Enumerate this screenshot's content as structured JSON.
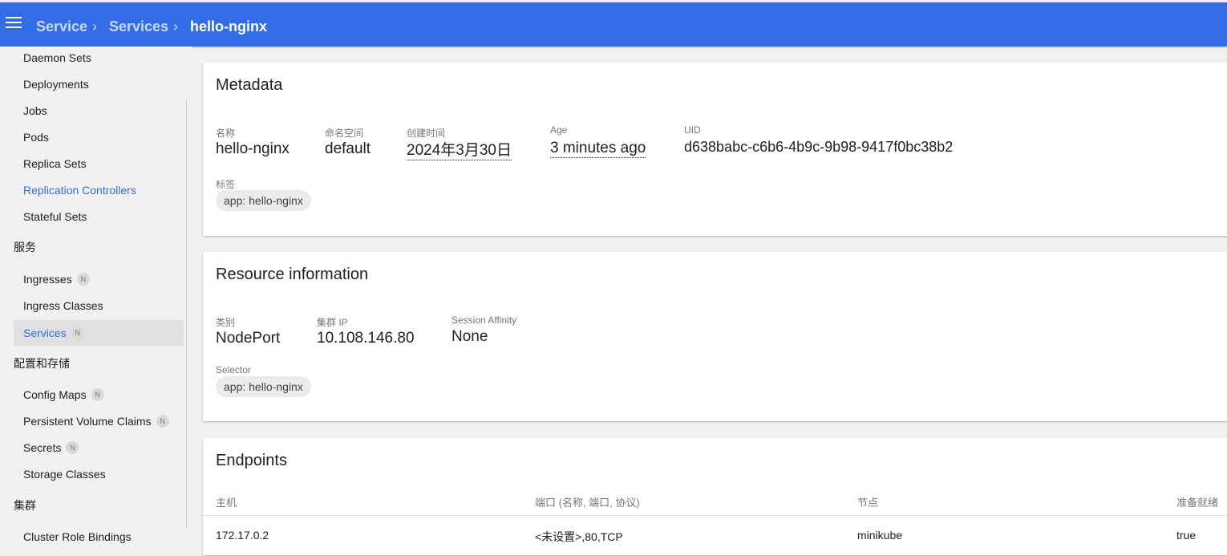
{
  "breadcrumb": {
    "items": [
      "Service",
      "Services"
    ],
    "current": "hello-nginx"
  },
  "sidebar": {
    "workloads": [
      "Daemon Sets",
      "Deployments",
      "Jobs",
      "Pods",
      "Replica Sets",
      "Replication Controllers",
      "Stateful Sets"
    ],
    "section_services": "服务",
    "services_items": [
      {
        "label": "Ingresses",
        "badge": "N"
      },
      {
        "label": "Ingress Classes"
      },
      {
        "label": "Services",
        "badge": "N",
        "selected": true
      }
    ],
    "section_config": "配置和存储",
    "config_items": [
      {
        "label": "Config Maps",
        "badge": "N"
      },
      {
        "label": "Persistent Volume Claims",
        "badge": "N"
      },
      {
        "label": "Secrets",
        "badge": "N"
      },
      {
        "label": "Storage Classes"
      }
    ],
    "section_cluster": "集群",
    "cluster_items": [
      {
        "label": "Cluster Role Bindings"
      }
    ]
  },
  "metadata": {
    "title": "Metadata",
    "name_label": "名称",
    "name": "hello-nginx",
    "namespace_label": "命名空间",
    "namespace": "default",
    "created_label": "创建时间",
    "created": "2024年3月30日",
    "age_label": "Age",
    "age": "3 minutes ago",
    "uid_label": "UID",
    "uid": "d638babc-c6b6-4b9c-9b98-9417f0bc38b2",
    "labels_label": "标签",
    "labels": [
      "app: hello-nginx"
    ]
  },
  "resource": {
    "title": "Resource information",
    "type_label": "类别",
    "type": "NodePort",
    "cluster_ip_label": "集群 IP",
    "cluster_ip": "10.108.146.80",
    "affinity_label": "Session Affinity",
    "affinity": "None",
    "selector_label": "Selector",
    "selector": [
      "app: hello-nginx"
    ]
  },
  "endpoints": {
    "title": "Endpoints",
    "columns": [
      "主机",
      "端口 (名称, 端口, 协议)",
      "节点",
      "准备就绪"
    ],
    "rows": [
      [
        "172.17.0.2",
        "<未设置>,80,TCP",
        "minikube",
        "true"
      ]
    ]
  },
  "colors": {
    "primary": "#326de6",
    "background": "#f1f1f1"
  }
}
